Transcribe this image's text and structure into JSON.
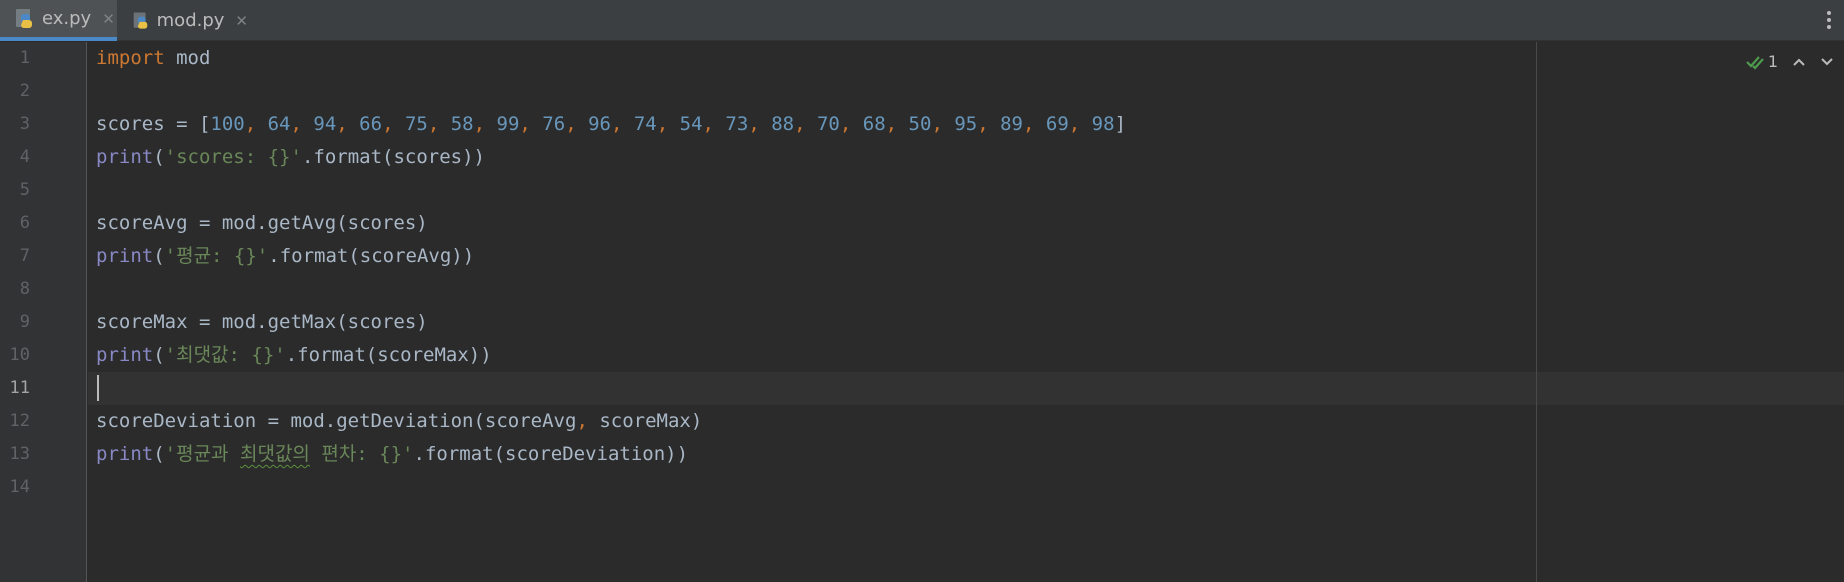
{
  "tabs": [
    {
      "label": "ex.py",
      "active": true,
      "icon": "python-file-icon"
    },
    {
      "label": "mod.py",
      "active": false,
      "icon": "python-file-icon"
    }
  ],
  "inspections": {
    "count": "1"
  },
  "editor": {
    "current_line": 11,
    "line_numbers": [
      "1",
      "2",
      "3",
      "4",
      "5",
      "6",
      "7",
      "8",
      "9",
      "10",
      "11",
      "12",
      "13",
      "14"
    ],
    "lines": [
      {
        "tokens": [
          {
            "t": "import",
            "c": "kw"
          },
          {
            "t": " mod",
            "c": ""
          }
        ]
      },
      {
        "tokens": []
      },
      {
        "tokens": [
          {
            "t": "scores = [",
            "c": ""
          },
          {
            "t": "100",
            "c": "num"
          },
          {
            "t": ", ",
            "c": "punc"
          },
          {
            "t": "64",
            "c": "num"
          },
          {
            "t": ", ",
            "c": "punc"
          },
          {
            "t": "94",
            "c": "num"
          },
          {
            "t": ", ",
            "c": "punc"
          },
          {
            "t": "66",
            "c": "num"
          },
          {
            "t": ", ",
            "c": "punc"
          },
          {
            "t": "75",
            "c": "num"
          },
          {
            "t": ", ",
            "c": "punc"
          },
          {
            "t": "58",
            "c": "num"
          },
          {
            "t": ", ",
            "c": "punc"
          },
          {
            "t": "99",
            "c": "num"
          },
          {
            "t": ", ",
            "c": "punc"
          },
          {
            "t": "76",
            "c": "num"
          },
          {
            "t": ", ",
            "c": "punc"
          },
          {
            "t": "96",
            "c": "num"
          },
          {
            "t": ", ",
            "c": "punc"
          },
          {
            "t": "74",
            "c": "num"
          },
          {
            "t": ", ",
            "c": "punc"
          },
          {
            "t": "54",
            "c": "num"
          },
          {
            "t": ", ",
            "c": "punc"
          },
          {
            "t": "73",
            "c": "num"
          },
          {
            "t": ", ",
            "c": "punc"
          },
          {
            "t": "88",
            "c": "num"
          },
          {
            "t": ", ",
            "c": "punc"
          },
          {
            "t": "70",
            "c": "num"
          },
          {
            "t": ", ",
            "c": "punc"
          },
          {
            "t": "68",
            "c": "num"
          },
          {
            "t": ", ",
            "c": "punc"
          },
          {
            "t": "50",
            "c": "num"
          },
          {
            "t": ", ",
            "c": "punc"
          },
          {
            "t": "95",
            "c": "num"
          },
          {
            "t": ", ",
            "c": "punc"
          },
          {
            "t": "89",
            "c": "num"
          },
          {
            "t": ", ",
            "c": "punc"
          },
          {
            "t": "69",
            "c": "num"
          },
          {
            "t": ", ",
            "c": "punc"
          },
          {
            "t": "98",
            "c": "num"
          },
          {
            "t": "]",
            "c": ""
          }
        ]
      },
      {
        "tokens": [
          {
            "t": "print",
            "c": "builtin"
          },
          {
            "t": "(",
            "c": ""
          },
          {
            "t": "'scores: {}'",
            "c": "str"
          },
          {
            "t": ".format(scores))",
            "c": ""
          }
        ]
      },
      {
        "tokens": []
      },
      {
        "tokens": [
          {
            "t": "scoreAvg = mod.getAvg(scores)",
            "c": ""
          }
        ]
      },
      {
        "tokens": [
          {
            "t": "print",
            "c": "builtin"
          },
          {
            "t": "(",
            "c": ""
          },
          {
            "t": "'평균: {}'",
            "c": "str"
          },
          {
            "t": ".format(scoreAvg))",
            "c": ""
          }
        ]
      },
      {
        "tokens": []
      },
      {
        "tokens": [
          {
            "t": "scoreMax = mod.getMax(scores)",
            "c": ""
          }
        ]
      },
      {
        "tokens": [
          {
            "t": "print",
            "c": "builtin"
          },
          {
            "t": "(",
            "c": ""
          },
          {
            "t": "'최댓값: {}'",
            "c": "str"
          },
          {
            "t": ".format(scoreMax))",
            "c": ""
          }
        ]
      },
      {
        "tokens": []
      },
      {
        "tokens": [
          {
            "t": "scoreDeviation = mod.getDeviation(scoreAvg",
            "c": ""
          },
          {
            "t": ", ",
            "c": "punc"
          },
          {
            "t": "scoreMax)",
            "c": ""
          }
        ]
      },
      {
        "tokens": [
          {
            "t": "print",
            "c": "builtin"
          },
          {
            "t": "(",
            "c": ""
          },
          {
            "t": "'평균과 ",
            "c": "str"
          },
          {
            "t": "최댓값의",
            "c": "str typo"
          },
          {
            "t": " 편차: {}'",
            "c": "str"
          },
          {
            "t": ".format(scoreDeviation))",
            "c": ""
          }
        ]
      },
      {
        "tokens": []
      }
    ]
  }
}
